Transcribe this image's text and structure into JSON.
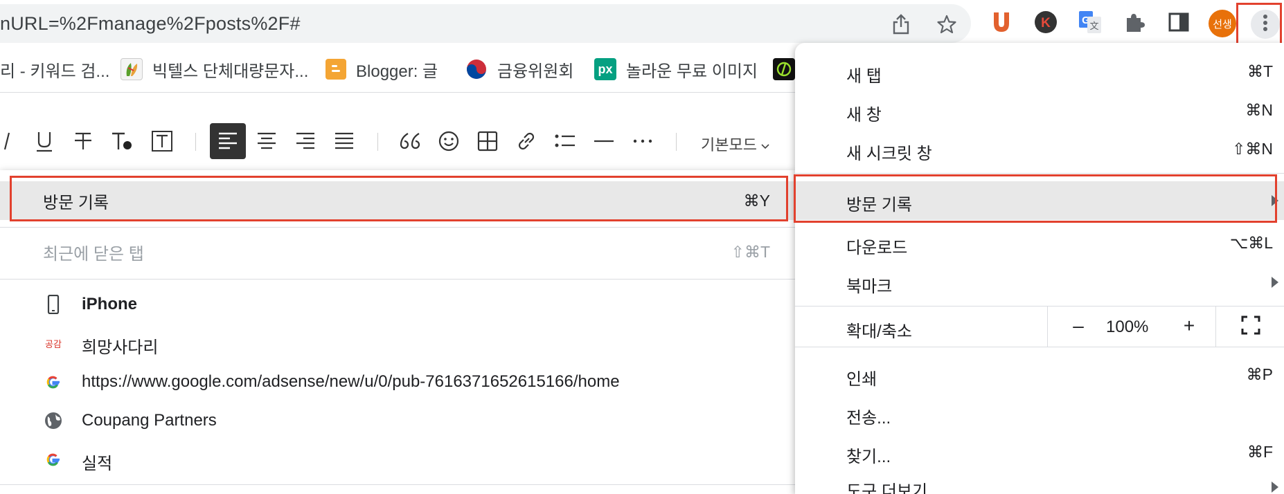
{
  "address_bar": {
    "url": "nURL=%2Fmanage%2Fposts%2F#"
  },
  "toolbar": {
    "profile_label": "선생"
  },
  "bookmarks": [
    {
      "label": "리 - 키워드 검...",
      "icon": "none"
    },
    {
      "label": "빅텔스 단체대량문자...",
      "icon": "leaf-favicon"
    },
    {
      "label": "Blogger: 글",
      "icon": "blogger-favicon"
    },
    {
      "label": "금융위원회",
      "icon": "taegeuk-favicon"
    },
    {
      "label": "놀라운 무료 이미지",
      "icon": "px-favicon"
    }
  ],
  "editor_toolbar": {
    "mode_label": "기본모드"
  },
  "history_submenu": {
    "history": {
      "label": "방문 기록",
      "shortcut": "⌘Y"
    },
    "recently_closed": {
      "label": "최근에 닫은 탭",
      "shortcut": "⇧⌘T"
    },
    "items": [
      {
        "label": "iPhone",
        "icon": "phone-icon",
        "bold": true
      },
      {
        "label": "희망사다리",
        "icon": "gonggam-favicon",
        "bold": false
      },
      {
        "label": "https://www.google.com/adsense/new/u/0/pub-7616371652615166/home",
        "icon": "google-favicon",
        "bold": false
      },
      {
        "label": "Coupang Partners",
        "icon": "globe-icon",
        "bold": false
      },
      {
        "label": "실적",
        "icon": "google-favicon",
        "bold": false
      }
    ]
  },
  "main_menu": {
    "new_tab": {
      "label": "새 탭",
      "shortcut": "⌘T"
    },
    "new_window": {
      "label": "새 창",
      "shortcut": "⌘N"
    },
    "new_incognito": {
      "label": "새 시크릿 창",
      "shortcut": "⇧⌘N"
    },
    "history": {
      "label": "방문 기록"
    },
    "downloads": {
      "label": "다운로드",
      "shortcut": "⌥⌘L"
    },
    "bookmarks": {
      "label": "북마크"
    },
    "zoom": {
      "label": "확대/축소",
      "minus": "–",
      "value": "100%",
      "plus": "+"
    },
    "print": {
      "label": "인쇄",
      "shortcut": "⌘P"
    },
    "cast": {
      "label": "전송..."
    },
    "find": {
      "label": "찾기...",
      "shortcut": "⌘F"
    },
    "more_tools": {
      "label": "도구 더보기"
    }
  },
  "colors": {
    "highlight_box": "#e2412e",
    "profile_avatar": "#e8710a"
  }
}
